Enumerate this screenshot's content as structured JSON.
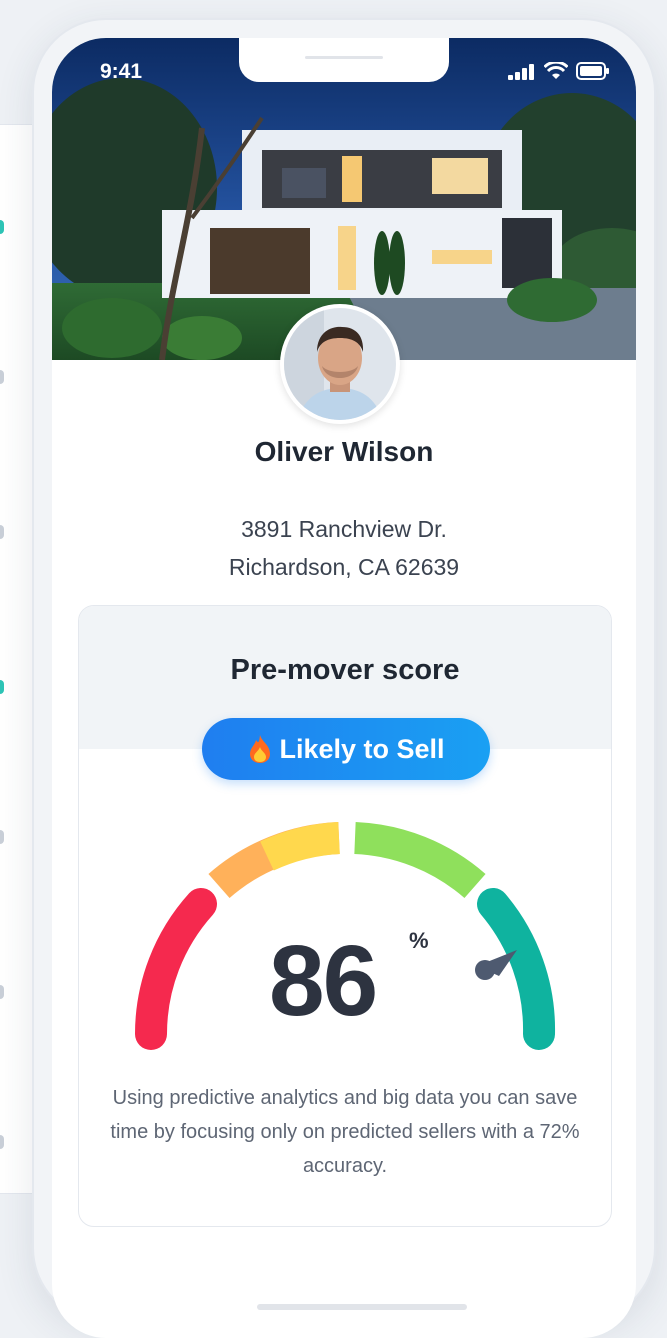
{
  "status_bar": {
    "time": "9:41"
  },
  "profile": {
    "name": "Oliver Wilson",
    "address_line1": "3891 Ranchview Dr.",
    "address_line2": "Richardson, CA 62639"
  },
  "score_card": {
    "title": "Pre-mover score",
    "badge_icon": "fire-icon",
    "badge_label": "Likely to Sell",
    "score": "86",
    "score_unit": "%",
    "description": "Using predictive analytics and big data you can save time by focusing only on predicted sellers with a 72% accuracy."
  },
  "colors": {
    "badge_blue": "#1f7ef0",
    "gauge_red": "#f5294e",
    "gauge_orange": "#ffb15a",
    "gauge_yellow": "#ffd84d",
    "gauge_green": "#8fe05c",
    "gauge_teal": "#0fb39f"
  }
}
